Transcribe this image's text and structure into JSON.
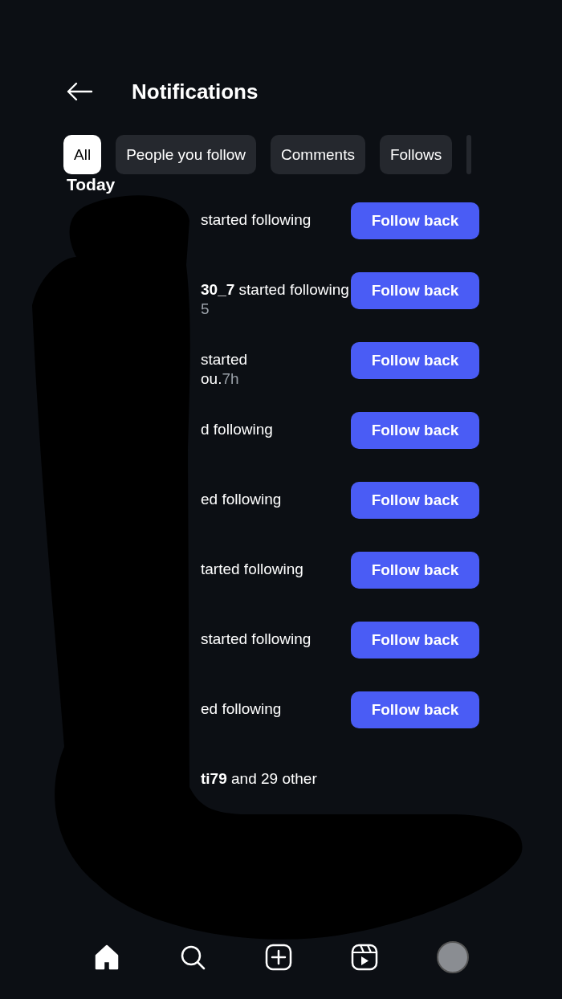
{
  "header": {
    "title": "Notifications"
  },
  "filters": [
    {
      "label": "All",
      "selected": true
    },
    {
      "label": "People you follow",
      "selected": false
    },
    {
      "label": "Comments",
      "selected": false
    },
    {
      "label": "Follows",
      "selected": false
    }
  ],
  "section": "Today",
  "notifications": [
    {
      "kind": "follow",
      "text": "started following",
      "button": "Follow back"
    },
    {
      "kind": "follow",
      "text": "**30_7** started following",
      "time": "5",
      "button": "Follow back"
    },
    {
      "kind": "follow",
      "text": "started",
      "subtext": "ou.",
      "time": "7h",
      "button": "Follow back"
    },
    {
      "kind": "follow",
      "text": "d following",
      "button": "Follow back"
    },
    {
      "kind": "follow",
      "text": "ed following",
      "button": "Follow back"
    },
    {
      "kind": "follow",
      "text": "tarted following",
      "button": "Follow back"
    },
    {
      "kind": "follow",
      "text": "started following",
      "button": "Follow back"
    },
    {
      "kind": "follow",
      "text": "ed following",
      "button": "Follow back"
    },
    {
      "kind": "group",
      "text": "**ti79** and 29 other"
    }
  ],
  "nav": [
    {
      "kind": "home",
      "selected": true
    },
    {
      "kind": "search",
      "selected": false
    },
    {
      "kind": "create",
      "selected": false
    },
    {
      "kind": "reels",
      "selected": false
    },
    {
      "kind": "profile",
      "selected": false
    }
  ]
}
